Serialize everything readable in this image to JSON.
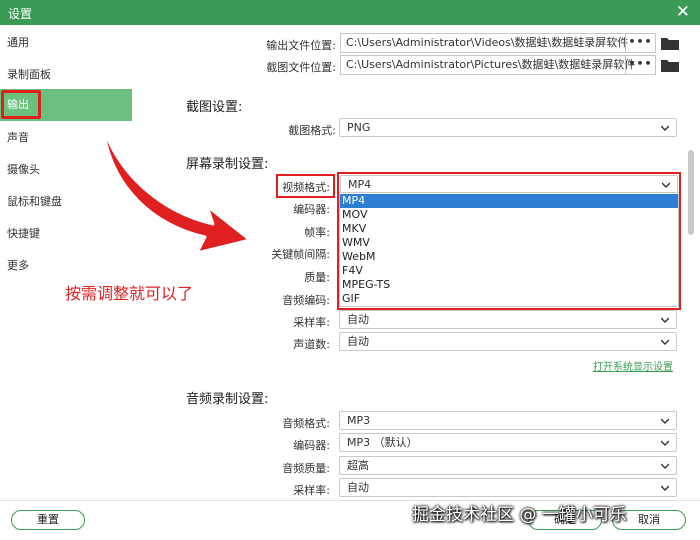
{
  "window": {
    "title": "设置",
    "close_glyph": "✕"
  },
  "sidebar": {
    "items": [
      {
        "label": "通用"
      },
      {
        "label": "录制面板"
      },
      {
        "label": "输出"
      },
      {
        "label": "声音"
      },
      {
        "label": "摄像头"
      },
      {
        "label": "鼠标和键盘"
      },
      {
        "label": "快捷键"
      },
      {
        "label": "更多"
      }
    ],
    "active_index": 2
  },
  "output_paths": {
    "video_label": "输出文件位置:",
    "video_path": "C:\\Users\\Administrator\\Videos\\数据蛙\\数据蛙录屏软件",
    "screenshot_label": "截图文件位置:",
    "screenshot_path": "C:\\Users\\Administrator\\Pictures\\数据蛙\\数据蛙录屏软件",
    "browse_glyph": "•••"
  },
  "screenshot_settings": {
    "title": "截图设置:",
    "format_label": "截图格式:",
    "format_value": "PNG"
  },
  "screen_recording": {
    "title": "屏幕录制设置:",
    "video_format_label": "视频格式:",
    "video_format_value": "MP4",
    "encoder_label": "编码器:",
    "framerate_label": "帧率:",
    "keyframe_label": "关键帧间隔:",
    "quality_label": "质量:",
    "audio_encoding_label": "音频编码:",
    "sample_rate_label": "采样率:",
    "sample_rate_value": "自动",
    "channels_label": "声道数:",
    "channels_value": "自动",
    "display_settings_link": "打开系统显示设置",
    "dropdown_options": [
      "MP4",
      "MOV",
      "MKV",
      "WMV",
      "WebM",
      "F4V",
      "MPEG-TS",
      "GIF"
    ],
    "dropdown_selected_index": 0
  },
  "audio_recording": {
    "title": "音频录制设置:",
    "format_label": "音频格式:",
    "format_value": "MP3",
    "encoder_label": "编码器:",
    "encoder_value": "MP3 （默认）",
    "quality_label": "音频质量:",
    "quality_value": "超高",
    "sample_rate_label": "采样率:",
    "sample_rate_value": "自动"
  },
  "annotation": {
    "instruction_text": "按需调整就可以了"
  },
  "footer": {
    "reset_label": "重置",
    "ok_label": "确定",
    "cancel_label": "取消"
  },
  "watermark": "掘金技术社区 @ 一罐小可乐",
  "colors": {
    "title_bar": "#3b9b55",
    "active_sidebar": "#6cc07d",
    "highlight_red": "#e02020",
    "selected_option": "#2d7fd3"
  }
}
